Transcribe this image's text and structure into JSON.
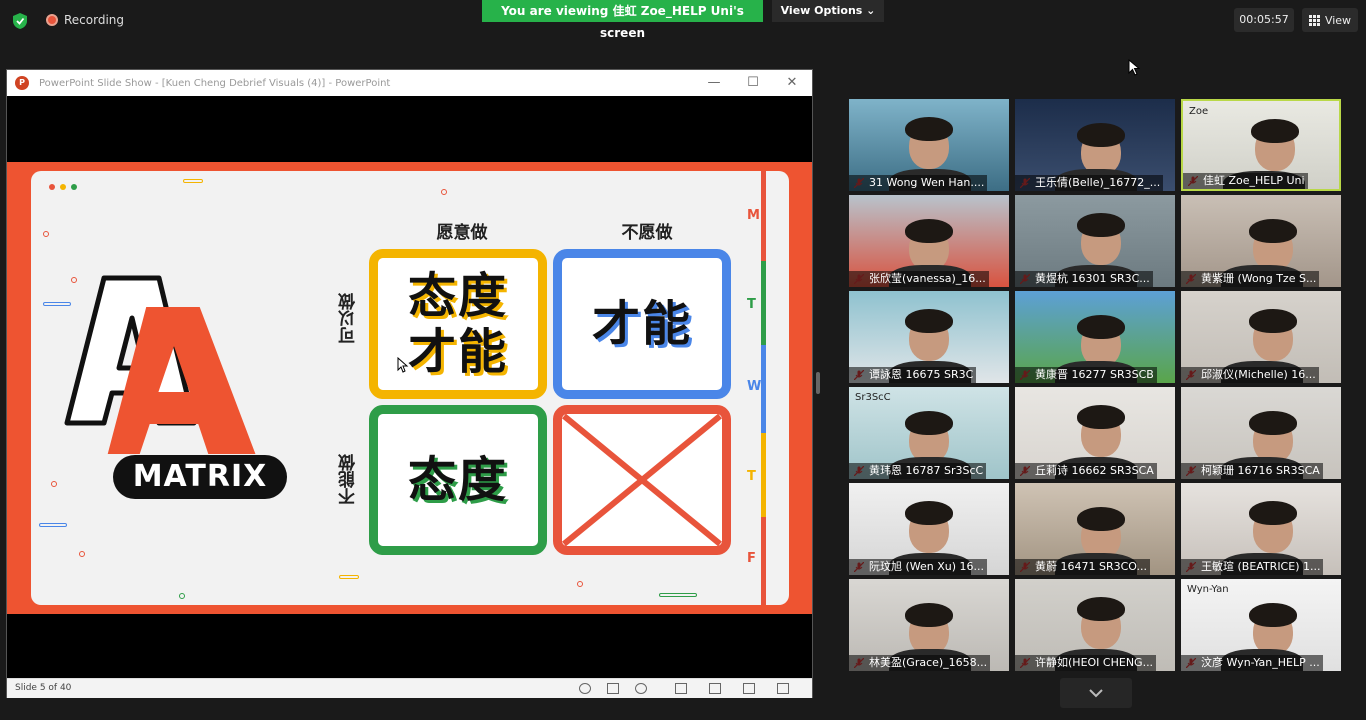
{
  "topbar": {
    "recording_label": "Recording",
    "banner_text": "You are viewing 佳虹 Zoe_HELP Uni's screen",
    "view_options_label": "View Options ⌄",
    "timer": "00:05:57",
    "view_label": "View"
  },
  "ppt": {
    "window_title": "PowerPoint Slide Show - [Kuen Cheng Debrief Visuals (4)] - PowerPoint",
    "slide_status": "Slide 5 of 40",
    "slide": {
      "logo_letters": "A",
      "logo_word": "MATRIX",
      "col_willing": "愿意做",
      "col_unwilling": "不愿做",
      "row_can": "可以做",
      "row_cannot": "不能做",
      "cell_top_left_line1": "态度",
      "cell_top_left_line2": "才能",
      "cell_top_right": "才能",
      "cell_bottom_left": "态度",
      "side_letters": [
        "M",
        "T",
        "W",
        "T",
        "F"
      ]
    }
  },
  "participants": [
    {
      "name": "31 Wong Wen Han...."
    },
    {
      "name": "王乐倩(Belle)_16772_..."
    },
    {
      "name": "佳虹 Zoe_HELP Uni",
      "corner_label": "Zoe"
    },
    {
      "name": "张欣莹(vanessa)_16..."
    },
    {
      "name": "黄煜杭 16301 SR3C..."
    },
    {
      "name": "黄紫珊 (Wong Tze S..."
    },
    {
      "name": "谭詠恩 16675 SR3C"
    },
    {
      "name": "黄康晋 16277 SR3SCB"
    },
    {
      "name": "邱淑仪(Michelle) 16..."
    },
    {
      "name": "黄玮恩 16787 Sr3ScC",
      "corner_label": "Sr3ScC"
    },
    {
      "name": "丘莉诗 16662 SR3SCA"
    },
    {
      "name": "柯颖珊 16716 SR3SCA"
    },
    {
      "name": "阮玟旭 (Wen Xu) 16..."
    },
    {
      "name": "黄蔚 16471  SR3CO..."
    },
    {
      "name": "王敏瑄 (BEATRICE) 1..."
    },
    {
      "name": "林美盈(Grace)_1658..."
    },
    {
      "name": "许静如(HEOI CHENG..."
    },
    {
      "name": "汶彦 Wyn-Yan_HELP ...",
      "corner_label": "Wyn-Yan"
    }
  ],
  "colors": {
    "banner_green": "#27b24a",
    "slide_orange": "#ee5431",
    "cell_yellow": "#f4b400",
    "cell_blue": "#4a86e8",
    "cell_green": "#2e9d48",
    "cell_red": "#e8543b",
    "active_speaker_border": "#b9d848"
  }
}
